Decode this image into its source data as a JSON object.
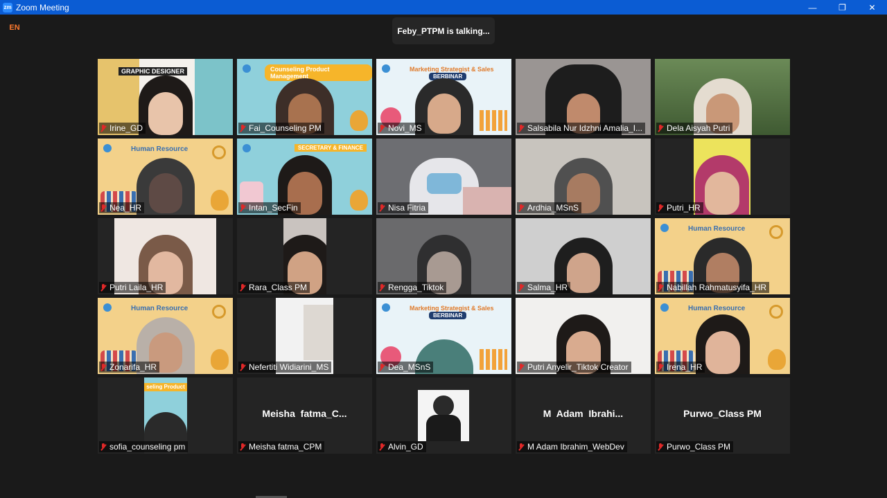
{
  "window": {
    "title": "Zoom Meeting",
    "app_icon": "zm"
  },
  "controls": {
    "minimize": "—",
    "restore": "❐",
    "close": "✕"
  },
  "language_badge": "EN",
  "talking_banner": "Feby_PTPM is talking...",
  "colors": {
    "titlebar": "#0b5cd3",
    "background": "#1a1a1a",
    "muted_mic": "#e02828"
  },
  "banners": {
    "counseling": "Counseling Product Management",
    "marketing": "Marketing Strategist & Sales",
    "berbinar": "BERBINAR",
    "human_resource": "Human Resource",
    "secretary": "SECRETARY & FINANCE",
    "graphic": "GRAPHIC DESIGNER",
    "counseling_partial": "seling Product"
  },
  "participants": [
    {
      "name": "Irine_GD"
    },
    {
      "name": "Fai_Counseling PM"
    },
    {
      "name": "Novi_MS"
    },
    {
      "name": "Salsabila Nur Idzhni Amalia_I..."
    },
    {
      "name": "Dela Aisyah Putri"
    },
    {
      "name": "Nea_HR"
    },
    {
      "name": "Intan_SecFin"
    },
    {
      "name": "Nisa Fitria"
    },
    {
      "name": "Ardhia_MSnS"
    },
    {
      "name": "Putri_HR"
    },
    {
      "name": "Putri Laila_HR"
    },
    {
      "name": "Rara_Class PM"
    },
    {
      "name": "Rengga_Tiktok"
    },
    {
      "name": "Salma_HR"
    },
    {
      "name": "Nabillah Rahmatusyifa_HR"
    },
    {
      "name": "Zonarifa_HR"
    },
    {
      "name": "Nefertiti Widiarini_MS"
    },
    {
      "name": "Dea_MSnS"
    },
    {
      "name": "Putri Anyelir_Tiktok Creator"
    },
    {
      "name": "Irena_HR"
    },
    {
      "name": "sofia_counseling pm"
    },
    {
      "name": "Meisha fatma_CPM",
      "display": "Meisha  fatma_C..."
    },
    {
      "name": "Alvin_GD"
    },
    {
      "name": "M Adam Ibrahim_WebDev",
      "display": "M  Adam  Ibrahi..."
    },
    {
      "name": "Purwo_Class PM",
      "display": "Purwo_Class PM"
    }
  ]
}
